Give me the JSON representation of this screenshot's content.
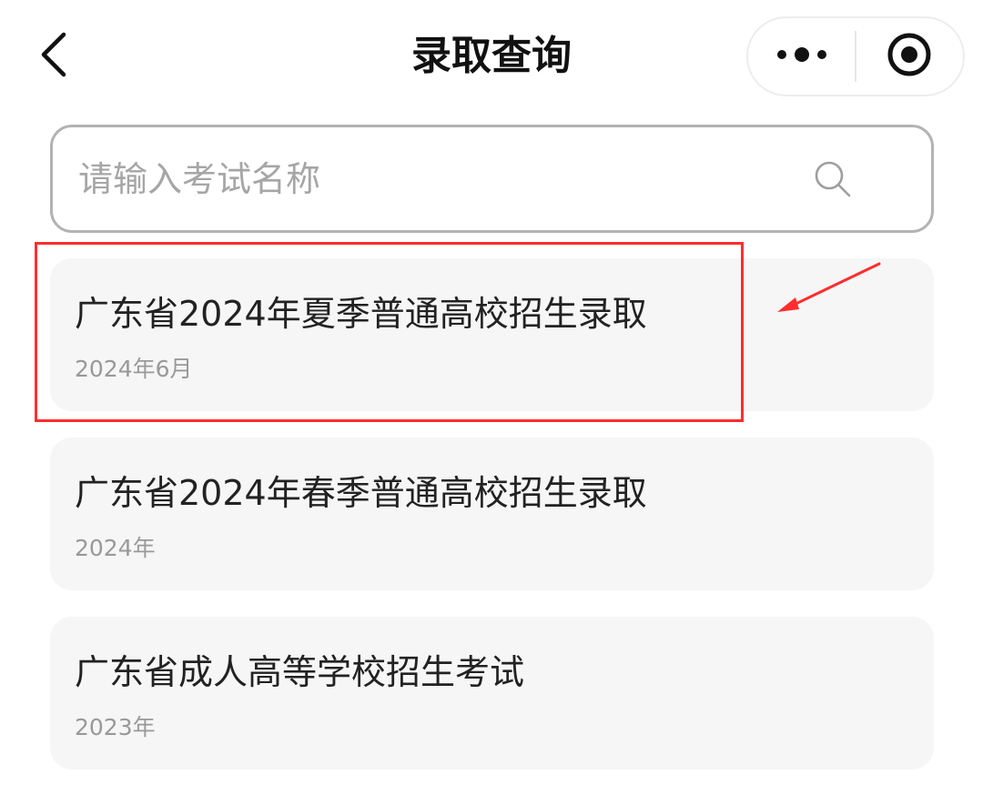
{
  "header": {
    "title": "录取查询"
  },
  "search": {
    "placeholder": "请输入考试名称"
  },
  "exams": [
    {
      "name": "广东省2024年夏季普通高校招生录取",
      "date": "2024年6月"
    },
    {
      "name": "广东省2024年春季普通高校招生录取",
      "date": "2024年"
    },
    {
      "name": "广东省成人高等学校招生考试",
      "date": "2023年"
    }
  ],
  "annotation": {
    "color": "#ff2d2d"
  }
}
